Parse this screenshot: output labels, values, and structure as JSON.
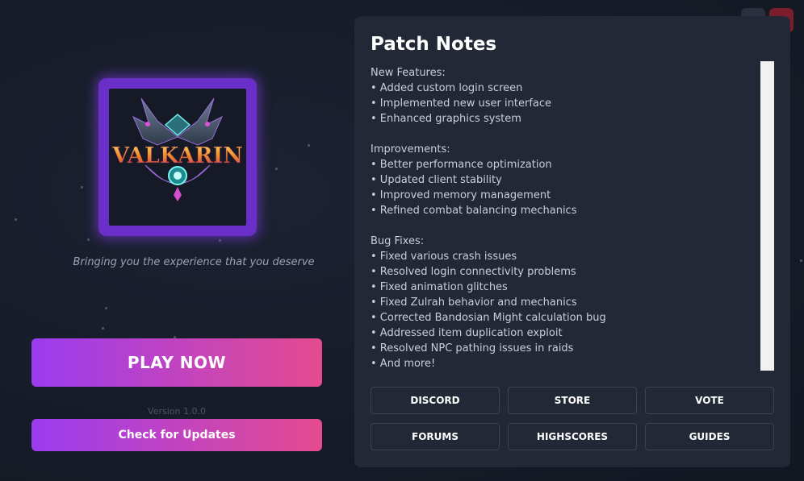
{
  "window": {
    "minimize_glyph": "–",
    "close_glyph": "✕"
  },
  "logo": {
    "wordmark": "VALKARIN"
  },
  "tagline": "Bringing you the experience that you deserve",
  "play_button": "PLAY NOW",
  "version": "Version 1.0.0",
  "update_button": "Check for Updates",
  "patch_notes": {
    "title": "Patch Notes",
    "sections": [
      {
        "heading": "New Features:",
        "items": [
          "• Added custom login screen",
          "• Implemented new user interface",
          "• Enhanced graphics system"
        ]
      },
      {
        "heading": "Improvements:",
        "items": [
          "• Better performance optimization",
          "• Updated client stability",
          "• Improved memory management",
          "• Refined combat balancing mechanics"
        ]
      },
      {
        "heading": "Bug Fixes:",
        "items": [
          "• Fixed various crash issues",
          "• Resolved login connectivity problems",
          "• Fixed animation glitches",
          "• Fixed Zulrah behavior and mechanics",
          "• Corrected Bandosian Might calculation bug",
          "• Addressed item duplication exploit",
          "• Resolved NPC pathing issues in raids",
          "• And more!"
        ]
      }
    ]
  },
  "links": [
    {
      "label": "DISCORD"
    },
    {
      "label": "STORE"
    },
    {
      "label": "VOTE"
    },
    {
      "label": "FORUMS"
    },
    {
      "label": "HIGHSCORES"
    },
    {
      "label": "GUIDES"
    }
  ],
  "colors": {
    "accent_start": "#9b3cf0",
    "accent_end": "#e54b8f",
    "panel_bg": "#222836",
    "close_bg": "#7a1e2c"
  }
}
